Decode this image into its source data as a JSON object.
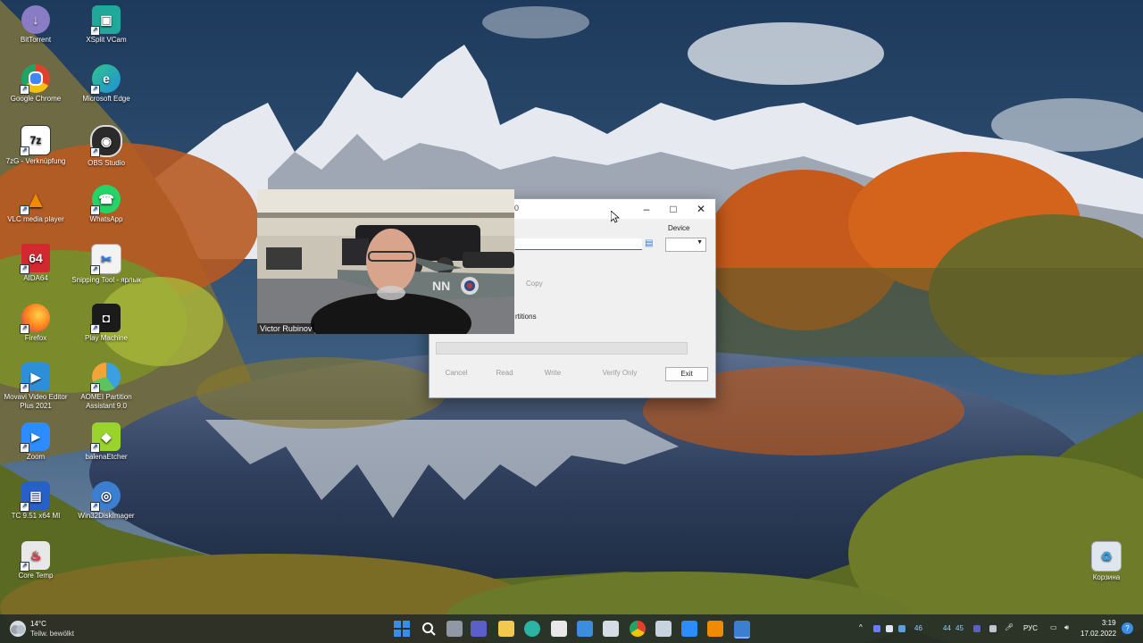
{
  "desktop_icons": [
    {
      "label": "BitTorrent",
      "color": "#8a7cc4",
      "glyph": "↓"
    },
    {
      "label": "XSplit VCam",
      "color": "#1fa99a",
      "glyph": "▣"
    },
    {
      "label": "Google Chrome",
      "color": "#e0412f",
      "glyph": "●"
    },
    {
      "label": "Microsoft Edge",
      "color": "#1f8fd8",
      "glyph": "e"
    },
    {
      "label": "7zG - Verknüpfung",
      "color": "#111111",
      "glyph": "7z"
    },
    {
      "label": "OBS Studio",
      "color": "#2b2b2b",
      "glyph": "◉"
    },
    {
      "label": "VLC media player",
      "color": "#f08a00",
      "glyph": "▲"
    },
    {
      "label": "WhatsApp",
      "color": "#25d366",
      "glyph": "☎"
    },
    {
      "label": "AIDA64",
      "color": "#d3282f",
      "glyph": "64"
    },
    {
      "label": "Snipping Tool - ярлык",
      "color": "#f3f3f3",
      "glyph": "✂"
    },
    {
      "label": "Firefox",
      "color": "#ff7a1a",
      "glyph": "●"
    },
    {
      "label": "Play Machine",
      "color": "#1b1b1b",
      "glyph": "■"
    },
    {
      "label": "Movavi Video Editor Plus 2021",
      "color": "#2d8fd8",
      "glyph": "▶"
    },
    {
      "label": "AOMEI Partition Assistant 9.0",
      "color": "#3aa0e0",
      "glyph": "◔"
    },
    {
      "label": "Zoom",
      "color": "#2d8cff",
      "glyph": "■"
    },
    {
      "label": "balenaEtcher",
      "color": "#9bd32e",
      "glyph": "◆"
    },
    {
      "label": "TC 9.51 x64 MI",
      "color": "#2660c8",
      "glyph": "▤"
    },
    {
      "label": "Win32DiskImager",
      "color": "#3c7fd0",
      "glyph": "◎"
    },
    {
      "label": "Core Temp",
      "color": "#e8e8e8",
      "glyph": "♨"
    }
  ],
  "recycle_bin": {
    "label": "Корзина"
  },
  "dialog": {
    "title_fragment": "0",
    "device_label": "Device",
    "copy_label": "Copy",
    "partitions_label": "rtitions",
    "buttons": {
      "cancel": "Cancel",
      "read": "Read",
      "write": "Write",
      "verify": "Verify Only",
      "exit": "Exit"
    }
  },
  "webcam": {
    "name": "Victor Rubinov"
  },
  "taskbar": {
    "weather_temp": "14°C",
    "weather_desc": "Teilw. bewölkt",
    "language": "РУС",
    "time": "3:19",
    "date": "17.02.2022",
    "tray_numbers": [
      "46",
      "44",
      "45"
    ],
    "app_colors": [
      "#2b7be4",
      "#222222",
      "#9aa0a6",
      "#5b5fc7",
      "#f2c94c",
      "#2bb3a3",
      "#3c8dde",
      "#e0412f",
      "#c8d3e0",
      "#4a78c2",
      "#2d8cff",
      "#f08a00",
      "#3c7fd0"
    ]
  },
  "colors": {
    "accent": "#1a73d1",
    "taskbar": "#19202a"
  }
}
